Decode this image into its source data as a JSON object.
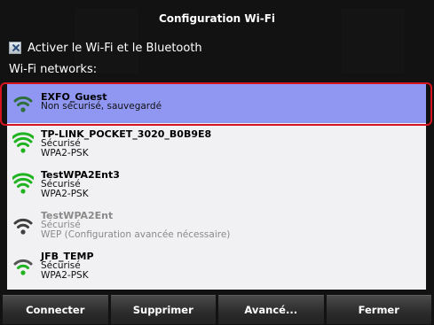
{
  "dialog": {
    "title": "Configuration Wi-Fi",
    "enable_checkbox": {
      "label": "Activer le Wi-Fi et le Bluetooth",
      "checked": true
    },
    "networks_label": "Wi-Fi networks:"
  },
  "networks": [
    {
      "ssid": "EXFO_Guest",
      "lines": [
        "Non sécurisé, sauvegardé"
      ],
      "selected": true,
      "signal_color": "#2f6f3a"
    },
    {
      "ssid": "TP-LINK_POCKET_3020_B0B9E8",
      "lines": [
        "Sécurisé",
        "WPA2-PSK"
      ],
      "selected": false,
      "signal_color": "#1fb31f"
    },
    {
      "ssid": "TestWPA2Ent3",
      "lines": [
        "Sécurisé",
        "WPA2-PSK"
      ],
      "selected": false,
      "signal_color": "#1fb31f"
    },
    {
      "ssid": "TestWPA2Ent",
      "lines": [
        "Sécurisé",
        "WEP (Configuration avancée nécessaire)"
      ],
      "selected": false,
      "signal_color": "#3f3f3f"
    },
    {
      "ssid": "JFB_TEMP",
      "lines": [
        "Sécurisé",
        "WPA2-PSK"
      ],
      "selected": false,
      "signal_color": "#1fb31f"
    }
  ],
  "buttons": {
    "connect": "Connecter",
    "delete": "Supprimer",
    "advanced": "Avancé...",
    "close": "Fermer"
  }
}
